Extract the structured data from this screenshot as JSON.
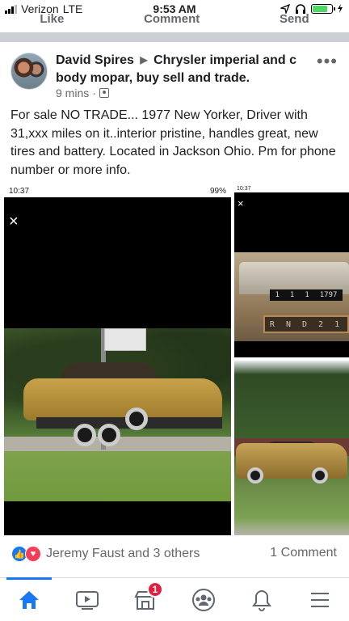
{
  "status_bar": {
    "carrier": "Verizon",
    "network": "LTE",
    "time": "9:53 AM"
  },
  "previous_post": {
    "actions": [
      "Like",
      "Comment",
      "Send"
    ]
  },
  "post": {
    "author": "David Spires",
    "group": "Chrysler imperial and c body mopar, buy sell and trade.",
    "time_ago": "9 mins",
    "body": "For sale NO TRADE... 1977 New Yorker, Driver with 31,xxx miles on it..interior pristine, handles great, new tires and battery. Located in Jackson Ohio. Pm for phone number or more info.",
    "media": {
      "left_shot_status_time": "10:37",
      "left_shot_battery": "99%",
      "right_top_status_time": "10:37",
      "odometer": [
        "1",
        "1",
        "1",
        "1797"
      ],
      "shifter": "R N D 2 1"
    }
  },
  "reactions": {
    "summary": "Jeremy Faust and 3 others",
    "comments": "1 Comment"
  },
  "tabbar": {
    "marketplace_badge": "1"
  },
  "colors": {
    "brand": "#1877f2",
    "badge": "#e41e3f",
    "love": "#f33e58"
  }
}
